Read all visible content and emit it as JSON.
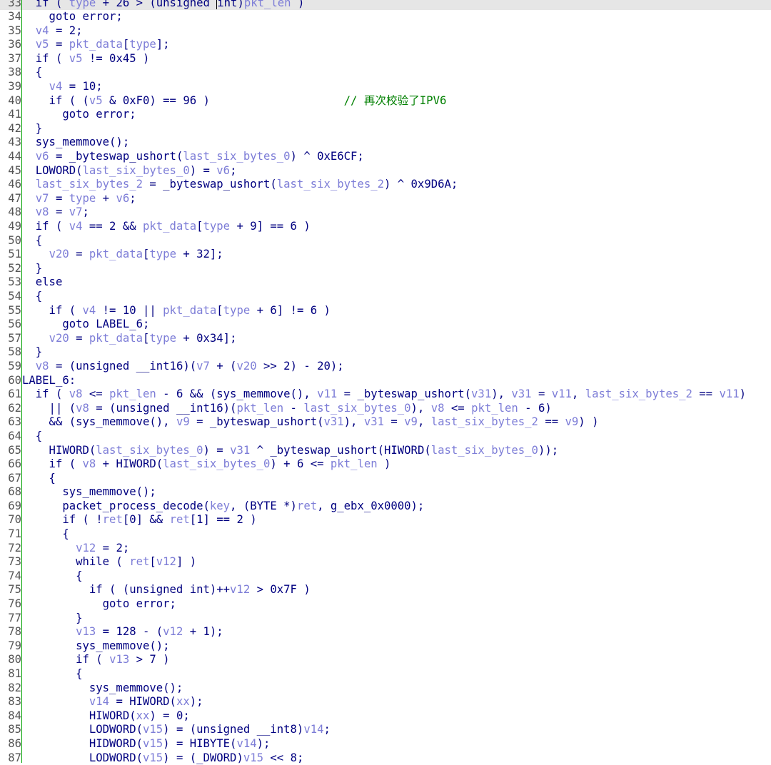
{
  "code_lines": [
    {
      "ln": "33",
      "current": true,
      "segs": [
        [
          "k",
          "  if ( "
        ],
        [
          "v",
          "type"
        ],
        [
          "k",
          " + 26 > (unsigned "
        ],
        [
          "cursor",
          ""
        ],
        [
          "k",
          "int)"
        ],
        [
          "v",
          "pkt_len"
        ],
        [
          "k",
          " )"
        ]
      ]
    },
    {
      "ln": "34",
      "segs": [
        [
          "k",
          "    goto error;"
        ]
      ]
    },
    {
      "ln": "35",
      "segs": [
        [
          "k",
          "  "
        ],
        [
          "v",
          "v4"
        ],
        [
          "k",
          " = 2;"
        ]
      ]
    },
    {
      "ln": "36",
      "segs": [
        [
          "k",
          "  "
        ],
        [
          "v",
          "v5"
        ],
        [
          "k",
          " = "
        ],
        [
          "v",
          "pkt_data"
        ],
        [
          "k",
          "["
        ],
        [
          "v",
          "type"
        ],
        [
          "k",
          "];"
        ]
      ]
    },
    {
      "ln": "37",
      "segs": [
        [
          "k",
          "  if ( "
        ],
        [
          "v",
          "v5"
        ],
        [
          "k",
          " != 0x45 )"
        ]
      ]
    },
    {
      "ln": "38",
      "segs": [
        [
          "k",
          "  {"
        ]
      ]
    },
    {
      "ln": "39",
      "segs": [
        [
          "k",
          "    "
        ],
        [
          "v",
          "v4"
        ],
        [
          "k",
          " = 10;"
        ]
      ]
    },
    {
      "ln": "40",
      "segs": [
        [
          "k",
          "    if ( ("
        ],
        [
          "v",
          "v5"
        ],
        [
          "k",
          " & 0xF0) == 96 )                    "
        ],
        [
          "c",
          "// 再次校验了IPV6"
        ]
      ]
    },
    {
      "ln": "41",
      "segs": [
        [
          "k",
          "      goto error;"
        ]
      ]
    },
    {
      "ln": "42",
      "segs": [
        [
          "k",
          "  }"
        ]
      ]
    },
    {
      "ln": "43",
      "segs": [
        [
          "k",
          "  sys_memmove();"
        ]
      ]
    },
    {
      "ln": "44",
      "segs": [
        [
          "k",
          "  "
        ],
        [
          "v",
          "v6"
        ],
        [
          "k",
          " = _byteswap_ushort("
        ],
        [
          "v",
          "last_six_bytes_0"
        ],
        [
          "k",
          ") ^ 0xE6CF;"
        ]
      ]
    },
    {
      "ln": "45",
      "segs": [
        [
          "k",
          "  LOWORD("
        ],
        [
          "v",
          "last_six_bytes_0"
        ],
        [
          "k",
          ") = "
        ],
        [
          "v",
          "v6"
        ],
        [
          "k",
          ";"
        ]
      ]
    },
    {
      "ln": "46",
      "segs": [
        [
          "k",
          "  "
        ],
        [
          "v",
          "last_six_bytes_2"
        ],
        [
          "k",
          " = _byteswap_ushort("
        ],
        [
          "v",
          "last_six_bytes_2"
        ],
        [
          "k",
          ") ^ 0x9D6A;"
        ]
      ]
    },
    {
      "ln": "47",
      "segs": [
        [
          "k",
          "  "
        ],
        [
          "v",
          "v7"
        ],
        [
          "k",
          " = "
        ],
        [
          "v",
          "type"
        ],
        [
          "k",
          " + "
        ],
        [
          "v",
          "v6"
        ],
        [
          "k",
          ";"
        ]
      ]
    },
    {
      "ln": "48",
      "segs": [
        [
          "k",
          "  "
        ],
        [
          "v",
          "v8"
        ],
        [
          "k",
          " = "
        ],
        [
          "v",
          "v7"
        ],
        [
          "k",
          ";"
        ]
      ]
    },
    {
      "ln": "49",
      "segs": [
        [
          "k",
          "  if ( "
        ],
        [
          "v",
          "v4"
        ],
        [
          "k",
          " == 2 && "
        ],
        [
          "v",
          "pkt_data"
        ],
        [
          "k",
          "["
        ],
        [
          "v",
          "type"
        ],
        [
          "k",
          " + 9] == 6 )"
        ]
      ]
    },
    {
      "ln": "50",
      "segs": [
        [
          "k",
          "  {"
        ]
      ]
    },
    {
      "ln": "51",
      "segs": [
        [
          "k",
          "    "
        ],
        [
          "v",
          "v20"
        ],
        [
          "k",
          " = "
        ],
        [
          "v",
          "pkt_data"
        ],
        [
          "k",
          "["
        ],
        [
          "v",
          "type"
        ],
        [
          "k",
          " + 32];"
        ]
      ]
    },
    {
      "ln": "52",
      "segs": [
        [
          "k",
          "  }"
        ]
      ]
    },
    {
      "ln": "53",
      "segs": [
        [
          "k",
          "  else"
        ]
      ]
    },
    {
      "ln": "54",
      "segs": [
        [
          "k",
          "  {"
        ]
      ]
    },
    {
      "ln": "55",
      "segs": [
        [
          "k",
          "    if ( "
        ],
        [
          "v",
          "v4"
        ],
        [
          "k",
          " != 10 || "
        ],
        [
          "v",
          "pkt_data"
        ],
        [
          "k",
          "["
        ],
        [
          "v",
          "type"
        ],
        [
          "k",
          " + 6] != 6 )"
        ]
      ]
    },
    {
      "ln": "56",
      "segs": [
        [
          "k",
          "      goto LABEL_6;"
        ]
      ]
    },
    {
      "ln": "57",
      "segs": [
        [
          "k",
          "    "
        ],
        [
          "v",
          "v20"
        ],
        [
          "k",
          " = "
        ],
        [
          "v",
          "pkt_data"
        ],
        [
          "k",
          "["
        ],
        [
          "v",
          "type"
        ],
        [
          "k",
          " + 0x34];"
        ]
      ]
    },
    {
      "ln": "58",
      "segs": [
        [
          "k",
          "  }"
        ]
      ]
    },
    {
      "ln": "59",
      "segs": [
        [
          "k",
          "  "
        ],
        [
          "v",
          "v8"
        ],
        [
          "k",
          " = (unsigned __int16)("
        ],
        [
          "v",
          "v7"
        ],
        [
          "k",
          " + ("
        ],
        [
          "v",
          "v20"
        ],
        [
          "k",
          " >> 2) - 20);"
        ]
      ]
    },
    {
      "ln": "60",
      "segs": [
        [
          "k",
          "LABEL_6:"
        ]
      ]
    },
    {
      "ln": "61",
      "segs": [
        [
          "k",
          "  if ( "
        ],
        [
          "v",
          "v8"
        ],
        [
          "k",
          " <= "
        ],
        [
          "v",
          "pkt_len"
        ],
        [
          "k",
          " - 6 && (sys_memmove(), "
        ],
        [
          "v",
          "v11"
        ],
        [
          "k",
          " = _byteswap_ushort("
        ],
        [
          "v",
          "v31"
        ],
        [
          "k",
          "), "
        ],
        [
          "v",
          "v31"
        ],
        [
          "k",
          " = "
        ],
        [
          "v",
          "v11"
        ],
        [
          "k",
          ", "
        ],
        [
          "v",
          "last_six_bytes_2"
        ],
        [
          "k",
          " == "
        ],
        [
          "v",
          "v11"
        ],
        [
          "k",
          ")"
        ]
      ]
    },
    {
      "ln": "62",
      "segs": [
        [
          "k",
          "    || ("
        ],
        [
          "v",
          "v8"
        ],
        [
          "k",
          " = (unsigned __int16)("
        ],
        [
          "v",
          "pkt_len"
        ],
        [
          "k",
          " - "
        ],
        [
          "v",
          "last_six_bytes_0"
        ],
        [
          "k",
          "), "
        ],
        [
          "v",
          "v8"
        ],
        [
          "k",
          " <= "
        ],
        [
          "v",
          "pkt_len"
        ],
        [
          "k",
          " - 6)"
        ]
      ]
    },
    {
      "ln": "63",
      "segs": [
        [
          "k",
          "    && (sys_memmove(), "
        ],
        [
          "v",
          "v9"
        ],
        [
          "k",
          " = _byteswap_ushort("
        ],
        [
          "v",
          "v31"
        ],
        [
          "k",
          "), "
        ],
        [
          "v",
          "v31"
        ],
        [
          "k",
          " = "
        ],
        [
          "v",
          "v9"
        ],
        [
          "k",
          ", "
        ],
        [
          "v",
          "last_six_bytes_2"
        ],
        [
          "k",
          " == "
        ],
        [
          "v",
          "v9"
        ],
        [
          "k",
          ") )"
        ]
      ]
    },
    {
      "ln": "64",
      "segs": [
        [
          "k",
          "  {"
        ]
      ]
    },
    {
      "ln": "65",
      "segs": [
        [
          "k",
          "    HIWORD("
        ],
        [
          "v",
          "last_six_bytes_0"
        ],
        [
          "k",
          ") = "
        ],
        [
          "v",
          "v31"
        ],
        [
          "k",
          " ^ _byteswap_ushort(HIWORD("
        ],
        [
          "v",
          "last_six_bytes_0"
        ],
        [
          "k",
          "));"
        ]
      ]
    },
    {
      "ln": "66",
      "segs": [
        [
          "k",
          "    if ( "
        ],
        [
          "v",
          "v8"
        ],
        [
          "k",
          " + HIWORD("
        ],
        [
          "v",
          "last_six_bytes_0"
        ],
        [
          "k",
          ") + 6 <= "
        ],
        [
          "v",
          "pkt_len"
        ],
        [
          "k",
          " )"
        ]
      ]
    },
    {
      "ln": "67",
      "segs": [
        [
          "k",
          "    {"
        ]
      ]
    },
    {
      "ln": "68",
      "segs": [
        [
          "k",
          "      sys_memmove();"
        ]
      ]
    },
    {
      "ln": "69",
      "segs": [
        [
          "k",
          "      packet_process_decode("
        ],
        [
          "v",
          "key"
        ],
        [
          "k",
          ", (BYTE *)"
        ],
        [
          "v",
          "ret"
        ],
        [
          "k",
          ", g_ebx_0x0000);"
        ]
      ]
    },
    {
      "ln": "70",
      "segs": [
        [
          "k",
          "      if ( !"
        ],
        [
          "v",
          "ret"
        ],
        [
          "k",
          "[0] && "
        ],
        [
          "v",
          "ret"
        ],
        [
          "k",
          "[1] == 2 )"
        ]
      ]
    },
    {
      "ln": "71",
      "segs": [
        [
          "k",
          "      {"
        ]
      ]
    },
    {
      "ln": "72",
      "segs": [
        [
          "k",
          "        "
        ],
        [
          "v",
          "v12"
        ],
        [
          "k",
          " = 2;"
        ]
      ]
    },
    {
      "ln": "73",
      "segs": [
        [
          "k",
          "        while ( "
        ],
        [
          "v",
          "ret"
        ],
        [
          "k",
          "["
        ],
        [
          "v",
          "v12"
        ],
        [
          "k",
          "] )"
        ]
      ]
    },
    {
      "ln": "74",
      "segs": [
        [
          "k",
          "        {"
        ]
      ]
    },
    {
      "ln": "75",
      "segs": [
        [
          "k",
          "          if ( (unsigned int)++"
        ],
        [
          "v",
          "v12"
        ],
        [
          "k",
          " > 0x7F )"
        ]
      ]
    },
    {
      "ln": "76",
      "segs": [
        [
          "k",
          "            goto error;"
        ]
      ]
    },
    {
      "ln": "77",
      "segs": [
        [
          "k",
          "        }"
        ]
      ]
    },
    {
      "ln": "78",
      "segs": [
        [
          "k",
          "        "
        ],
        [
          "v",
          "v13"
        ],
        [
          "k",
          " = 128 - ("
        ],
        [
          "v",
          "v12"
        ],
        [
          "k",
          " + 1);"
        ]
      ]
    },
    {
      "ln": "79",
      "segs": [
        [
          "k",
          "        sys_memmove();"
        ]
      ]
    },
    {
      "ln": "80",
      "segs": [
        [
          "k",
          "        if ( "
        ],
        [
          "v",
          "v13"
        ],
        [
          "k",
          " > 7 )"
        ]
      ]
    },
    {
      "ln": "81",
      "segs": [
        [
          "k",
          "        {"
        ]
      ]
    },
    {
      "ln": "82",
      "segs": [
        [
          "k",
          "          sys_memmove();"
        ]
      ]
    },
    {
      "ln": "83",
      "segs": [
        [
          "k",
          "          "
        ],
        [
          "v",
          "v14"
        ],
        [
          "k",
          " = HIWORD("
        ],
        [
          "v",
          "xx"
        ],
        [
          "k",
          ");"
        ]
      ]
    },
    {
      "ln": "84",
      "segs": [
        [
          "k",
          "          HIWORD("
        ],
        [
          "v",
          "xx"
        ],
        [
          "k",
          ") = 0;"
        ]
      ]
    },
    {
      "ln": "85",
      "segs": [
        [
          "k",
          "          LODWORD("
        ],
        [
          "v",
          "v15"
        ],
        [
          "k",
          ") = (unsigned __int8)"
        ],
        [
          "v",
          "v14"
        ],
        [
          "k",
          ";"
        ]
      ]
    },
    {
      "ln": "86",
      "segs": [
        [
          "k",
          "          HIDWORD("
        ],
        [
          "v",
          "v15"
        ],
        [
          "k",
          ") = HIBYTE("
        ],
        [
          "v",
          "v14"
        ],
        [
          "k",
          ");"
        ]
      ]
    },
    {
      "ln": "87",
      "segs": [
        [
          "k",
          "          LODWORD("
        ],
        [
          "v",
          "v15"
        ],
        [
          "k",
          ") = (_DWORD)"
        ],
        [
          "v",
          "v15"
        ],
        [
          "k",
          " << 8;"
        ]
      ]
    }
  ]
}
